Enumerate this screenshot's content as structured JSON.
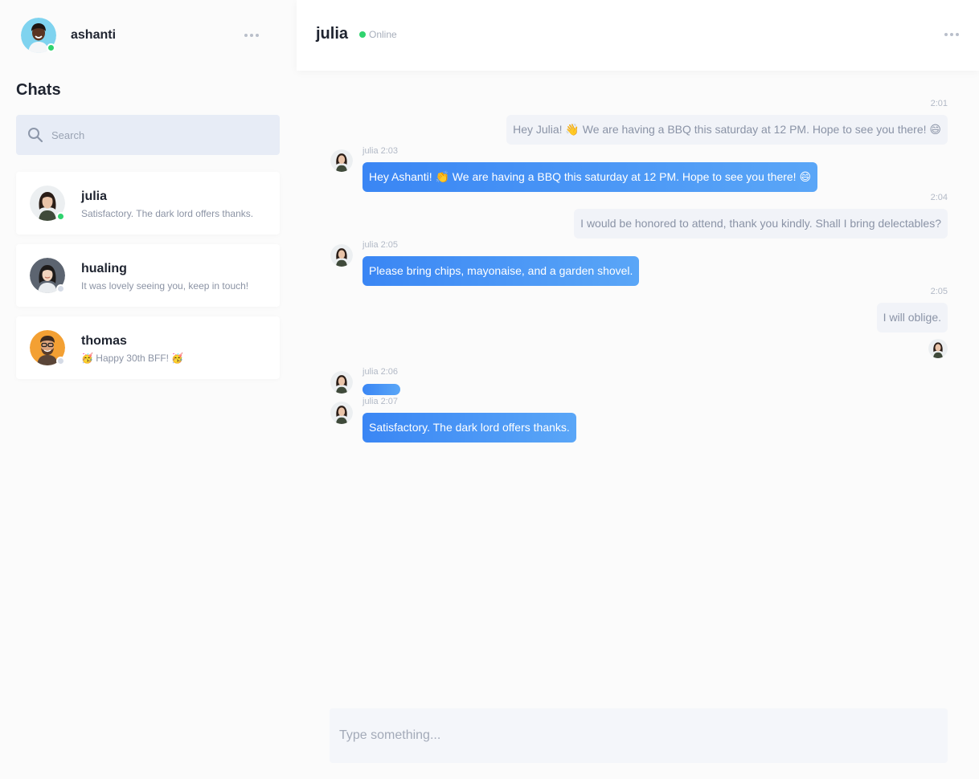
{
  "me": {
    "name": "ashanti",
    "status_color": "#2fd36e"
  },
  "sidebar": {
    "title": "Chats",
    "search": {
      "placeholder": "Search",
      "value": ""
    },
    "chats": [
      {
        "name": "julia",
        "preview": "Satisfactory. The dark lord offers thanks.",
        "online": true
      },
      {
        "name": "hualing",
        "preview": "It was lovely seeing you, keep in touch!",
        "online": false
      },
      {
        "name": "thomas",
        "preview": "🥳 Happy 30th BFF! 🥳",
        "online": false
      }
    ]
  },
  "conversation": {
    "partner": "julia",
    "status": "Online",
    "messages": [
      {
        "time": "2:01",
        "text": "Hey Julia! 👋 We are having a BBQ this saturday at 12 PM. Hope to see you there! 😄"
      },
      {
        "meta": "julia 2:03",
        "text": "Hey Ashanti! 👏 We are having a BBQ this saturday at 12 PM. Hope to see you there! 😄"
      },
      {
        "time": "2:04",
        "text": "I would be honored to attend, thank you kindly. Shall I bring delectables?"
      },
      {
        "meta": "julia 2:05",
        "text": "Please bring chips, mayonaise, and a garden shovel."
      },
      {
        "time": "2:05",
        "text": "I will oblige."
      },
      {
        "meta": "julia 2:06"
      },
      {
        "meta": "julia 2:07",
        "text": "Satisfactory. The dark lord offers thanks."
      }
    ],
    "composer_placeholder": "Type something..."
  },
  "colors": {
    "accent": "#3a86f4",
    "online": "#2fd36e",
    "offline": "#d5dbe6"
  }
}
